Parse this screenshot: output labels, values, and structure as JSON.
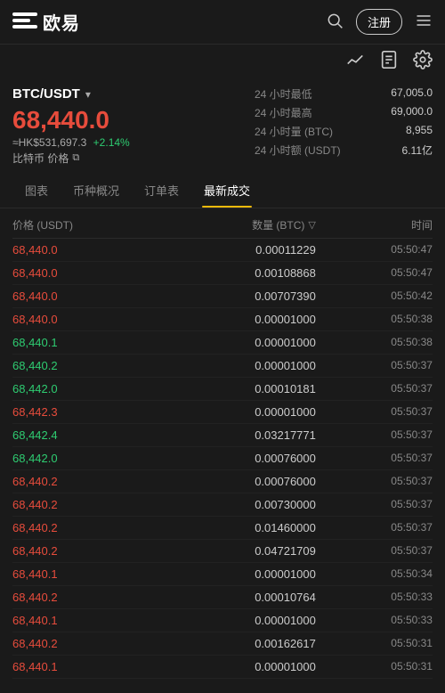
{
  "header": {
    "logo_text": "欧易",
    "register_label": "注册",
    "search_aria": "search",
    "menu_aria": "menu"
  },
  "pair": {
    "name": "BTC/USDT",
    "price": "68,440.0",
    "hk_price": "≈HK$531,697.3",
    "change_pct": "+2.14%",
    "btc_label": "比特币 价格",
    "stats": [
      {
        "label": "24 小时最低",
        "value": "67,005.0"
      },
      {
        "label": "24 小时最高",
        "value": "69,000.0"
      },
      {
        "label": "24 小时量 (BTC)",
        "value": "8,955"
      },
      {
        "label": "24 小时额 (USDT)",
        "value": "6.11亿"
      }
    ]
  },
  "tabs": [
    {
      "id": "chart",
      "label": "图表"
    },
    {
      "id": "overview",
      "label": "币种概况"
    },
    {
      "id": "orders",
      "label": "订单表"
    },
    {
      "id": "trades",
      "label": "最新成交",
      "active": true
    }
  ],
  "trades_table": {
    "col_price": "价格 (USDT)",
    "col_qty": "数量 (BTC)",
    "col_time": "时间",
    "rows": [
      {
        "price": "68,440.0",
        "side": "sell",
        "qty": "0.00011229",
        "time": "05:50:47"
      },
      {
        "price": "68,440.0",
        "side": "sell",
        "qty": "0.00108868",
        "time": "05:50:47"
      },
      {
        "price": "68,440.0",
        "side": "sell",
        "qty": "0.00707390",
        "time": "05:50:42"
      },
      {
        "price": "68,440.0",
        "side": "sell",
        "qty": "0.00001000",
        "time": "05:50:38"
      },
      {
        "price": "68,440.1",
        "side": "buy",
        "qty": "0.00001000",
        "time": "05:50:38"
      },
      {
        "price": "68,440.2",
        "side": "buy",
        "qty": "0.00001000",
        "time": "05:50:37"
      },
      {
        "price": "68,442.0",
        "side": "buy",
        "qty": "0.00010181",
        "time": "05:50:37"
      },
      {
        "price": "68,442.3",
        "side": "sell",
        "qty": "0.00001000",
        "time": "05:50:37"
      },
      {
        "price": "68,442.4",
        "side": "buy",
        "qty": "0.03217771",
        "time": "05:50:37"
      },
      {
        "price": "68,442.0",
        "side": "buy",
        "qty": "0.00076000",
        "time": "05:50:37"
      },
      {
        "price": "68,440.2",
        "side": "sell",
        "qty": "0.00076000",
        "time": "05:50:37"
      },
      {
        "price": "68,440.2",
        "side": "sell",
        "qty": "0.00730000",
        "time": "05:50:37"
      },
      {
        "price": "68,440.2",
        "side": "sell",
        "qty": "0.01460000",
        "time": "05:50:37"
      },
      {
        "price": "68,440.2",
        "side": "sell",
        "qty": "0.04721709",
        "time": "05:50:37"
      },
      {
        "price": "68,440.1",
        "side": "sell",
        "qty": "0.00001000",
        "time": "05:50:34"
      },
      {
        "price": "68,440.2",
        "side": "sell",
        "qty": "0.00010764",
        "time": "05:50:33"
      },
      {
        "price": "68,440.1",
        "side": "sell",
        "qty": "0.00001000",
        "time": "05:50:33"
      },
      {
        "price": "68,440.2",
        "side": "sell",
        "qty": "0.00162617",
        "time": "05:50:31"
      },
      {
        "price": "68,440.1",
        "side": "sell",
        "qty": "0.00001000",
        "time": "05:50:31"
      }
    ]
  }
}
